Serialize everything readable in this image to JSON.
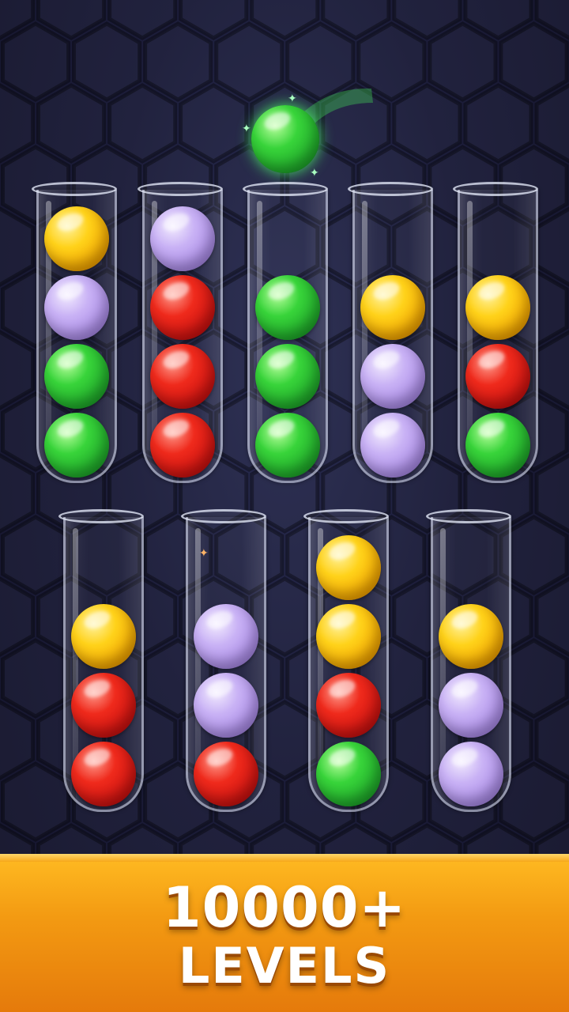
{
  "banner": {
    "count": "10000+",
    "label": "LEVELS"
  },
  "colors": {
    "background": "#1c1d3a",
    "banner": "#f39a12",
    "yellow": "#ffd21a",
    "purple": "#c9b2f5",
    "green": "#38d43a",
    "red": "#ef2a1c"
  },
  "held_ball": {
    "color": "green"
  },
  "tubes": [
    {
      "balls": [
        "yellow",
        "purple",
        "green",
        "green"
      ]
    },
    {
      "balls": [
        "purple",
        "red",
        "red",
        "red"
      ]
    },
    {
      "balls": [
        "green",
        "green",
        "green"
      ]
    },
    {
      "balls": [
        "yellow",
        "purple",
        "purple"
      ]
    },
    {
      "balls": [
        "yellow",
        "red",
        "green"
      ]
    },
    {
      "balls": [
        "yellow",
        "red",
        "red"
      ]
    },
    {
      "balls": [
        "purple",
        "purple",
        "red"
      ]
    },
    {
      "balls": [
        "yellow",
        "yellow",
        "red",
        "green"
      ]
    },
    {
      "balls": [
        "yellow",
        "purple",
        "purple"
      ]
    }
  ]
}
